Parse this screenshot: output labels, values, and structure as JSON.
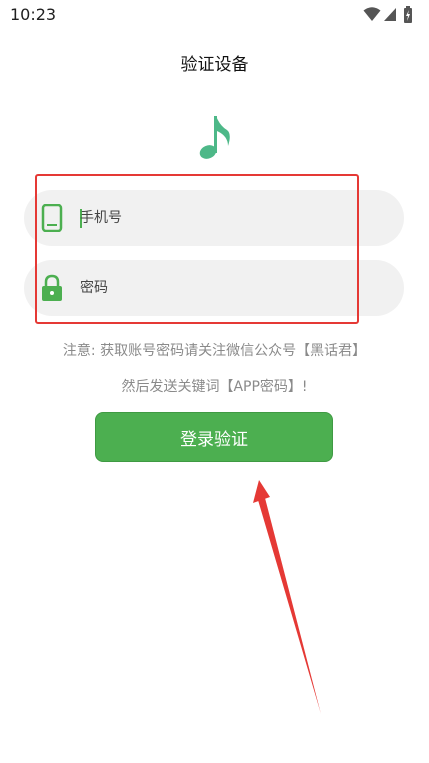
{
  "status_bar": {
    "time": "10:23"
  },
  "page": {
    "title": "验证设备"
  },
  "form": {
    "phone_placeholder": "手机号",
    "password_placeholder": "密码"
  },
  "notice": {
    "line1": "注意: 获取账号密码请关注微信公众号【黑话君】",
    "line2": "然后发送关键词【APP密码】!"
  },
  "actions": {
    "login_label": "登录验证"
  },
  "colors": {
    "accent": "#4caf50",
    "annotation": "#e53935"
  },
  "icons": {
    "logo": "music-note-icon",
    "phone": "phone-icon",
    "password": "lock-icon"
  }
}
